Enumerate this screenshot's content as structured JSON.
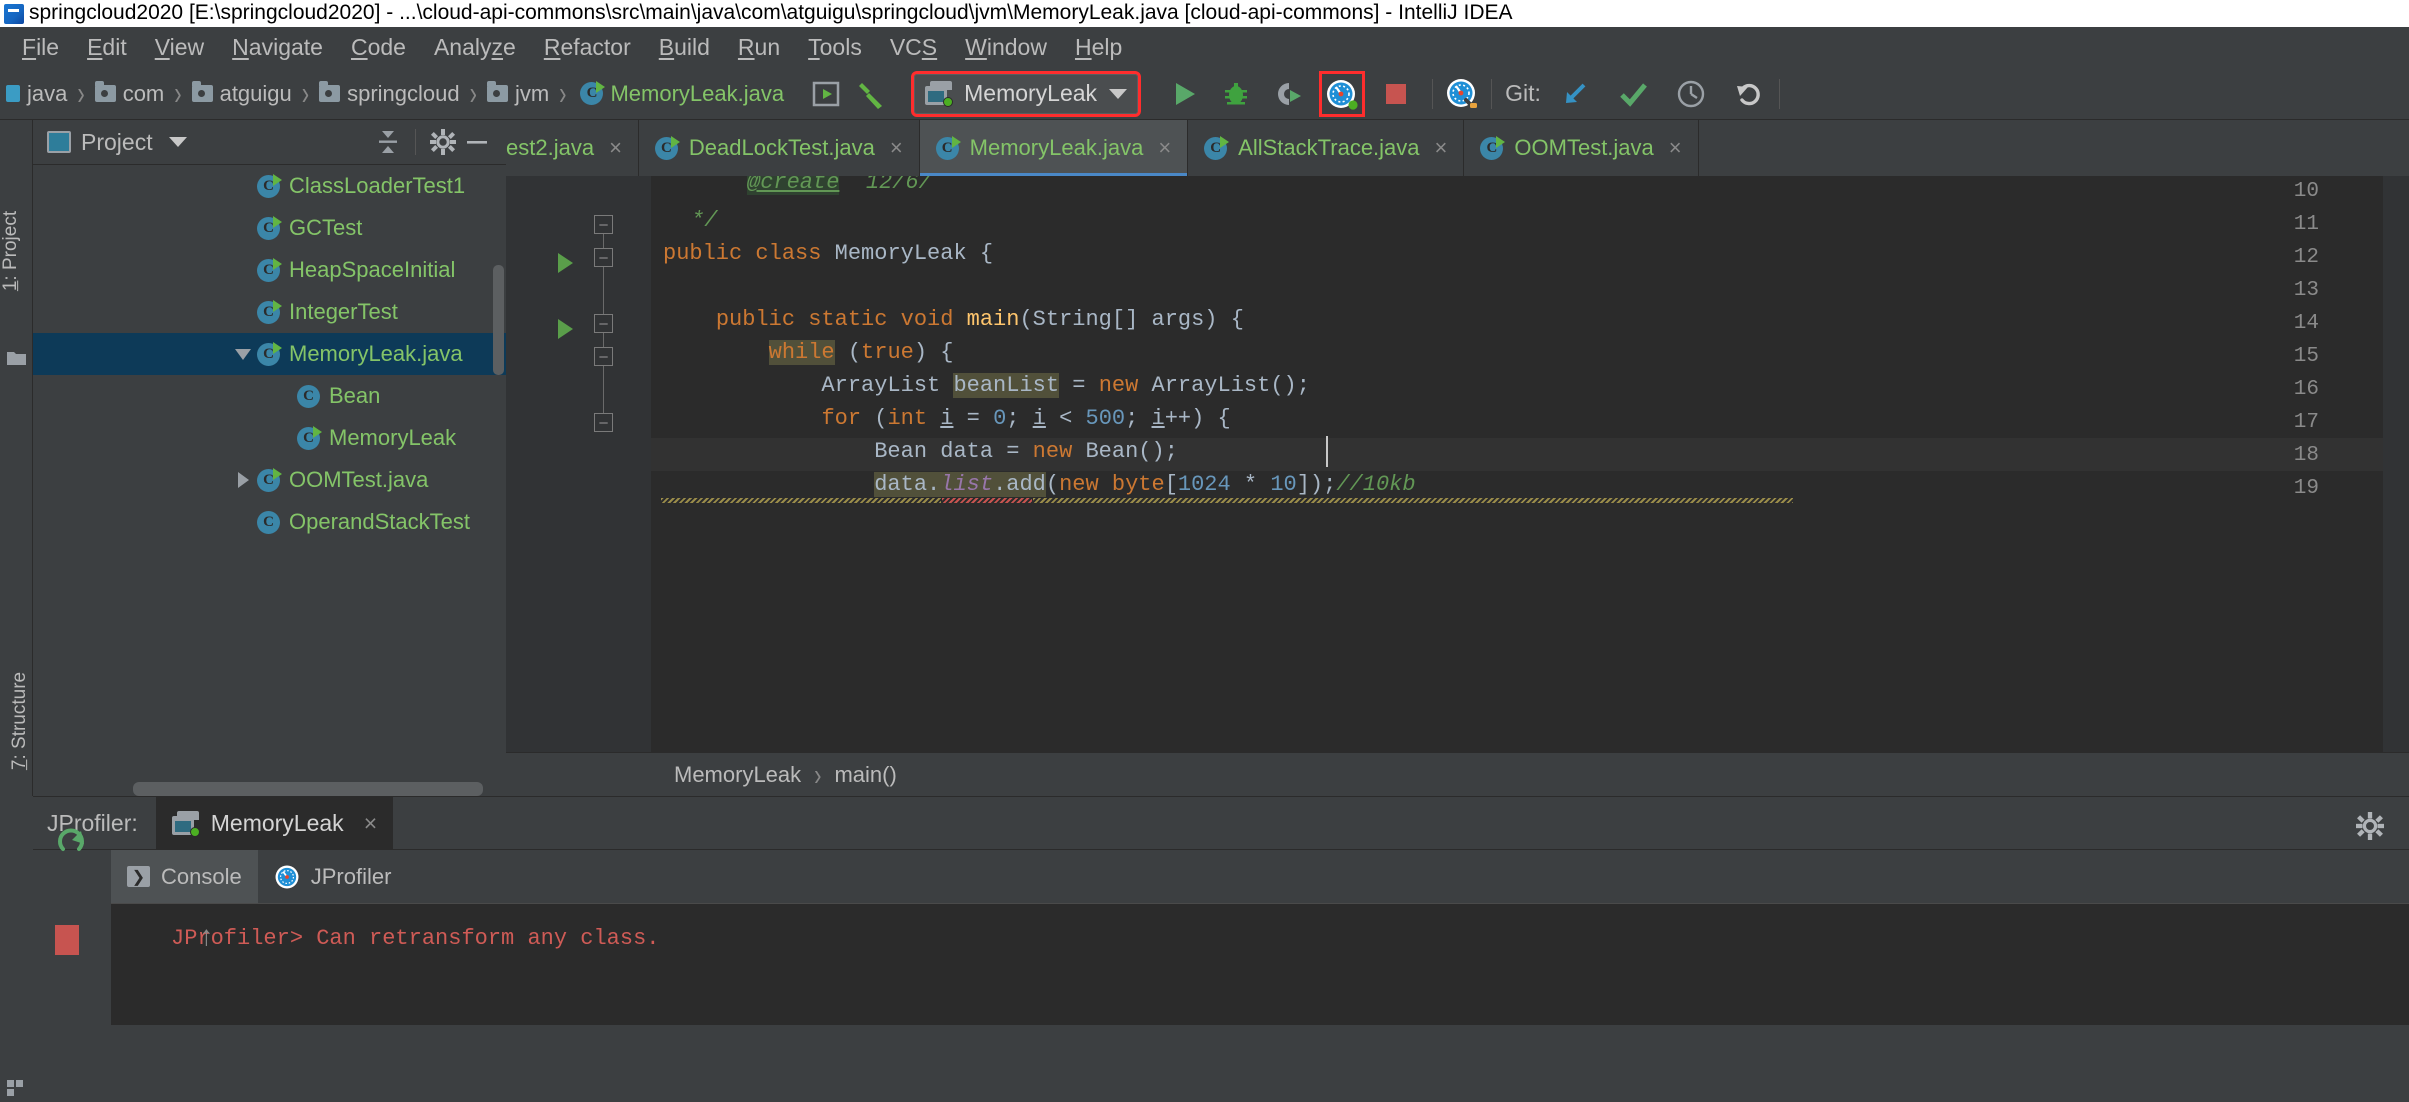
{
  "window": {
    "title": "springcloud2020 [E:\\springcloud2020] - ...\\cloud-api-commons\\src\\main\\java\\com\\atguigu\\springcloud\\jvm\\MemoryLeak.java [cloud-api-commons] - IntelliJ IDEA",
    "app_icon": "intellij-idea-icon"
  },
  "menubar": {
    "items": [
      {
        "label": "File",
        "mnemonic": "F"
      },
      {
        "label": "Edit",
        "mnemonic": "E"
      },
      {
        "label": "View",
        "mnemonic": "V"
      },
      {
        "label": "Navigate",
        "mnemonic": "N"
      },
      {
        "label": "Code",
        "mnemonic": "C"
      },
      {
        "label": "Analyze",
        "mnemonic": "z"
      },
      {
        "label": "Refactor",
        "mnemonic": "R"
      },
      {
        "label": "Build",
        "mnemonic": "B"
      },
      {
        "label": "Run",
        "mnemonic": "R"
      },
      {
        "label": "Tools",
        "mnemonic": "T"
      },
      {
        "label": "VCS",
        "mnemonic": "S"
      },
      {
        "label": "Window",
        "mnemonic": "W"
      },
      {
        "label": "Help",
        "mnemonic": "H"
      }
    ]
  },
  "navbar": {
    "breadcrumbs": [
      {
        "label": "java",
        "icon": "source-root-icon"
      },
      {
        "label": "com",
        "icon": "folder-icon"
      },
      {
        "label": "atguigu",
        "icon": "folder-icon"
      },
      {
        "label": "springcloud",
        "icon": "folder-icon"
      },
      {
        "label": "jvm",
        "icon": "folder-icon"
      },
      {
        "label": "MemoryLeak.java",
        "icon": "java-class-runnable-icon"
      }
    ],
    "separator": "›",
    "run_config": {
      "name": "MemoryLeak",
      "icon": "run-configuration-icon",
      "caret": "chevron-down-icon",
      "highlighted": true
    },
    "buttons": [
      {
        "name": "select-run-configuration-icon",
        "label": ""
      },
      {
        "name": "build-project-hammer-icon",
        "label": ""
      },
      {
        "name": "run-button",
        "label": ""
      },
      {
        "name": "debug-button",
        "label": ""
      },
      {
        "name": "run-with-coverage-button",
        "label": ""
      },
      {
        "name": "jprofiler-run-button",
        "label": ""
      },
      {
        "name": "stop-button",
        "label": ""
      },
      {
        "name": "jprofiler-attach-button",
        "label": ""
      }
    ],
    "git": {
      "label": "Git:",
      "actions": [
        "update-project-icon",
        "commit-icon",
        "history-icon",
        "rollback-icon"
      ]
    }
  },
  "left_stripe": {
    "project_label": "1: Project",
    "project_mnemonic": "1",
    "structure_label": "7: Structure",
    "structure_mnemonic": "7"
  },
  "project_panel": {
    "title": "Project",
    "caret": "chevron-down-icon",
    "toolbar": [
      "collapse-all-icon",
      "gear-icon",
      "hide-icon"
    ],
    "tree": [
      {
        "label": "ClassLoaderTest1",
        "icon": "java-class-runnable-icon",
        "indent": 7,
        "twisty": "",
        "selected": false
      },
      {
        "label": "GCTest",
        "icon": "java-class-runnable-icon",
        "indent": 7,
        "twisty": "",
        "selected": false
      },
      {
        "label": "HeapSpaceInitial",
        "icon": "java-class-runnable-icon",
        "indent": 7,
        "twisty": "",
        "selected": false
      },
      {
        "label": "IntegerTest",
        "icon": "java-class-runnable-icon",
        "indent": 7,
        "twisty": "",
        "selected": false
      },
      {
        "label": "MemoryLeak.java",
        "icon": "java-class-runnable-icon",
        "indent": 6,
        "twisty": "expanded",
        "selected": true
      },
      {
        "label": "Bean",
        "icon": "java-class-icon",
        "indent": 8,
        "twisty": "",
        "selected": false
      },
      {
        "label": "MemoryLeak",
        "icon": "java-class-runnable-icon",
        "indent": 8,
        "twisty": "",
        "selected": false
      },
      {
        "label": "OOMTest.java",
        "icon": "java-class-runnable-icon",
        "indent": 6,
        "twisty": "collapsed",
        "selected": false
      },
      {
        "label": "OperandStackTest",
        "icon": "java-class-icon",
        "indent": 7,
        "twisty": "",
        "selected": false
      }
    ]
  },
  "editor": {
    "tabs": [
      {
        "label": "est2.java",
        "icon": "java-class-icon",
        "active": false,
        "close": "×",
        "clipped": true
      },
      {
        "label": "DeadLockTest.java",
        "icon": "java-class-runnable-icon",
        "active": false,
        "close": "×"
      },
      {
        "label": "MemoryLeak.java",
        "icon": "java-class-runnable-icon",
        "active": true,
        "close": "×"
      },
      {
        "label": "AllStackTrace.java",
        "icon": "java-class-runnable-icon",
        "active": false,
        "close": "×"
      },
      {
        "label": "OOMTest.java",
        "icon": "java-class-runnable-icon",
        "active": false,
        "close": "×"
      }
    ],
    "lines": [
      {
        "num": "10",
        "text": "@create  12/6/",
        "clipped_top": true
      },
      {
        "num": "11",
        "text": " */",
        "fold": "end"
      },
      {
        "num": "12",
        "text": "public class MemoryLeak {",
        "gutter_run": true,
        "fold": "start"
      },
      {
        "num": "13",
        "text": ""
      },
      {
        "num": "14",
        "text": "    public static void main(String[] args) {",
        "gutter_run": true,
        "fold": "start"
      },
      {
        "num": "15",
        "text": "        while (true) {",
        "fold": "start"
      },
      {
        "num": "16",
        "text": "            ArrayList beanList = new ArrayList();"
      },
      {
        "num": "17",
        "text": "            for (int i = 0; i < 500; i++) {",
        "fold": "start"
      },
      {
        "num": "18",
        "text": "                Bean data = new Bean();",
        "caret_line": true
      },
      {
        "num": "19",
        "text": "                data.list.add(new byte[1024 * 10]);//10kb"
      }
    ],
    "breadcrumb": {
      "class": "MemoryLeak",
      "method": "main()",
      "separator": "›"
    }
  },
  "bottom_panel": {
    "label": "JProfiler:",
    "tab": {
      "label": "MemoryLeak",
      "icon": "run-configuration-icon",
      "close": "×"
    },
    "settings_icon": "gear-icon",
    "subtabs": [
      {
        "label": "Console",
        "icon": "console-icon",
        "active": true
      },
      {
        "label": "JProfiler",
        "icon": "jprofiler-gauge-icon",
        "active": false
      }
    ],
    "side_buttons": [
      "rerun-icon",
      "stop-icon",
      "soft-wrap-icon"
    ],
    "console_output": "JProfiler> Can retransform any class."
  },
  "colors": {
    "accent_blue": "#4a88c7",
    "run_green": "#62b543",
    "error_red": "#cf5b56",
    "highlight_red": "#ff2d2d",
    "selection_blue": "#0d3a58",
    "editor_bg": "#2b2b2b",
    "panel_bg": "#3c3f41",
    "keyword_orange": "#cc7832",
    "number_blue": "#6897bb",
    "class_green": "#84c468"
  }
}
